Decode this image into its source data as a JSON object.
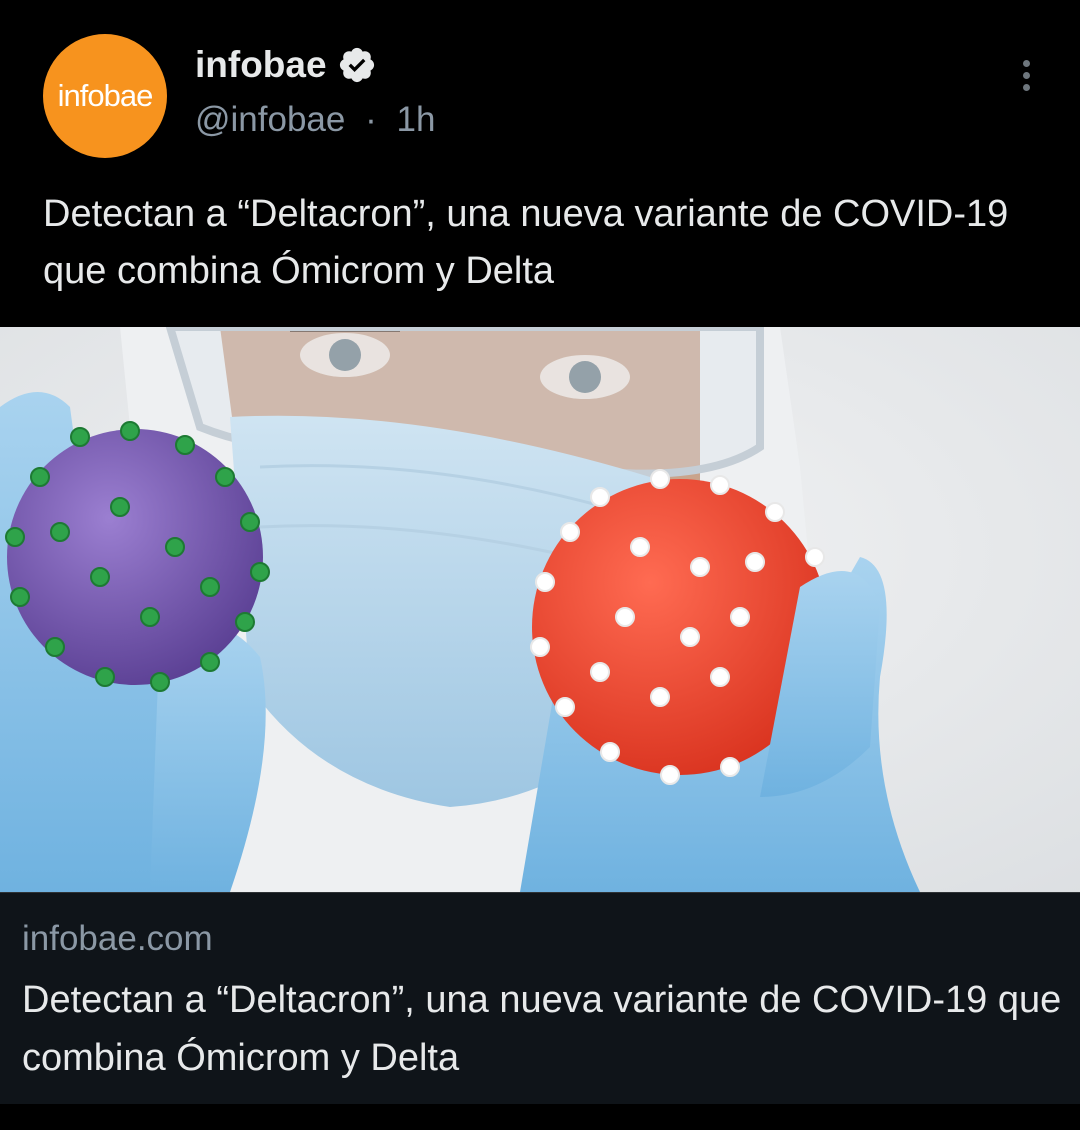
{
  "account": {
    "avatar_text": "infobae",
    "avatar_color": "#f7931e",
    "name": "infobae",
    "verified": true,
    "handle": "@infobae",
    "separator": "·",
    "time": "1h"
  },
  "tweet": {
    "text": "Detectan a “Deltacron”, una nueva variante de COVID-19 que combina Ómicrom y Delta"
  },
  "card": {
    "domain": "infobae.com",
    "title": "Detectan a “Deltacron”, una nueva variante de COVID-19 que combina Ómicrom y Delta"
  },
  "icons": {
    "verified": "verified-badge-icon",
    "more": "more-options-icon"
  }
}
